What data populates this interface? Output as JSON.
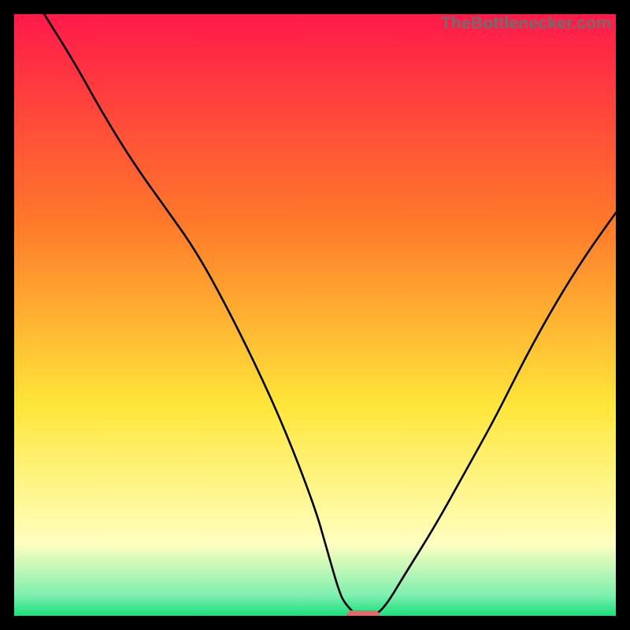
{
  "attribution": "TheBottlenecker.com",
  "colors": {
    "frame": "#000000",
    "gradient_top": "#ff1a4a",
    "gradient_mid1": "#ff7a2a",
    "gradient_mid2": "#ffe63a",
    "gradient_band": "#ffffc0",
    "gradient_bottom": "#18e07a",
    "curve": "#000000",
    "marker": "#e46a6a",
    "attribution_text": "#6e6e6e"
  },
  "chart_data": {
    "type": "line",
    "title": "",
    "xlabel": "",
    "ylabel": "",
    "xlim": [
      0,
      100
    ],
    "ylim": [
      0,
      100
    ],
    "grid": false,
    "legend": false,
    "series": [
      {
        "name": "bottleneck-curve",
        "x": [
          5,
          10,
          15,
          20,
          25,
          30,
          35,
          40,
          45,
          50,
          52,
          54,
          55,
          57,
          60,
          62,
          65,
          70,
          75,
          80,
          85,
          90,
          95,
          100
        ],
        "y": [
          100,
          92,
          83,
          75,
          68,
          61,
          52,
          42,
          31,
          18,
          11,
          4,
          2,
          0,
          0,
          2,
          7,
          15,
          24,
          33,
          43,
          52,
          60,
          67
        ]
      }
    ],
    "annotations": [
      {
        "type": "marker",
        "shape": "pill",
        "x": 58,
        "y": 0,
        "color": "#e46a6a"
      }
    ],
    "background": {
      "type": "vertical-gradient",
      "stops": [
        {
          "pos": 0.0,
          "color": "#ff1a4a"
        },
        {
          "pos": 0.35,
          "color": "#ff7a2a"
        },
        {
          "pos": 0.65,
          "color": "#ffe63a"
        },
        {
          "pos": 0.88,
          "color": "#ffffc0"
        },
        {
          "pos": 0.965,
          "color": "#7ff0b0"
        },
        {
          "pos": 1.0,
          "color": "#18e07a"
        }
      ]
    }
  }
}
